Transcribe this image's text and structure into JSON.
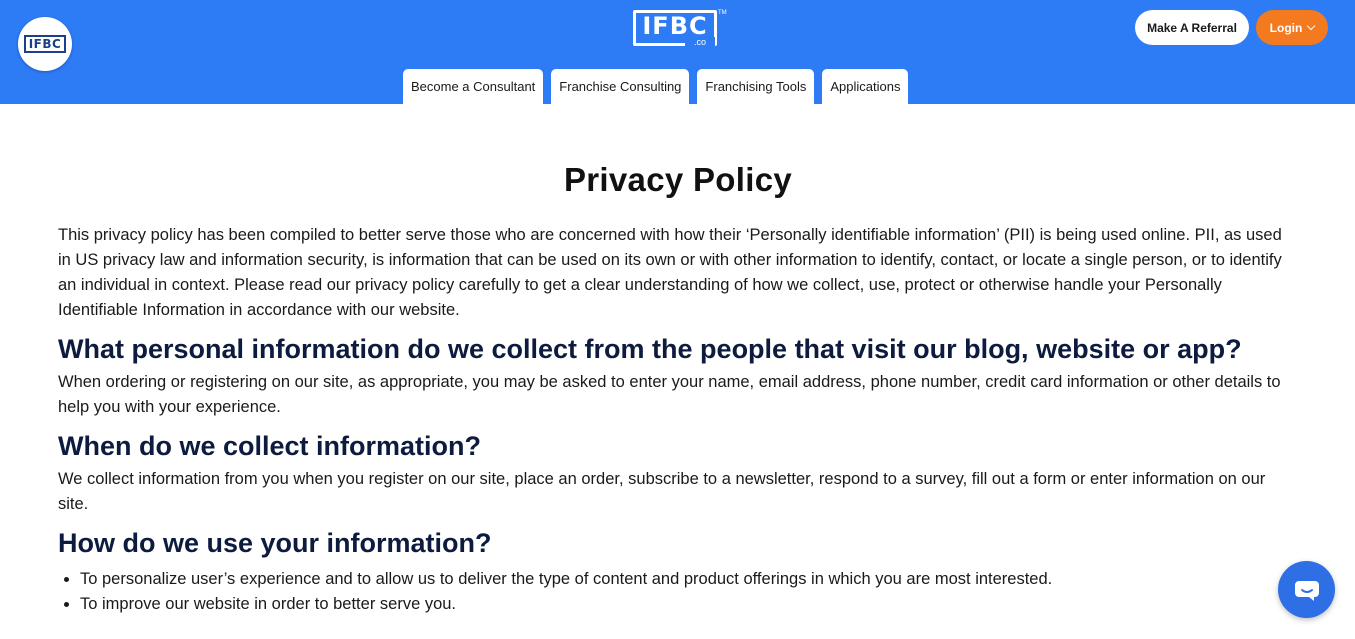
{
  "header": {
    "side_logo_text": "IFBC",
    "logo_main": "IFBC",
    "logo_sub": ".co",
    "logo_tm": "TM",
    "referral_label": "Make A Referral",
    "login_label": "Login",
    "brand_color": "#2e7bf6",
    "login_color": "#f47a1f"
  },
  "nav": {
    "tabs": [
      {
        "label": "Become a Consultant"
      },
      {
        "label": "Franchise Consulting"
      },
      {
        "label": "Franchising Tools"
      },
      {
        "label": "Applications"
      }
    ]
  },
  "main": {
    "title": "Privacy Policy",
    "intro": "This privacy policy has been compiled to better serve those who are concerned with how their ‘Personally identifiable information’ (PII) is being used online. PII, as used in US privacy law and information security, is information that can be used on its own or with other information to identify, contact, or locate a single person, or to identify an individual in context. Please read our privacy policy carefully to get a clear understanding of how we collect, use, protect or otherwise handle your Personally Identifiable Information in accordance with our website.",
    "sections": [
      {
        "heading": "What personal information do we collect from the people that visit our blog, website or app?",
        "body": "When ordering or registering on our site, as appropriate, you may be asked to enter your name, email address, phone number, credit card information or other details to help you with your experience."
      },
      {
        "heading": "When do we collect information?",
        "body": "We collect information from you when you register on our site, place an order, subscribe to a newsletter, respond to a survey, fill out a form or enter information on our site."
      },
      {
        "heading": "How do we use your information?",
        "items": [
          "To personalize user’s experience and to allow us to deliver the type of content and product offerings in which you are most interested.",
          "To improve our website in order to better serve you."
        ]
      }
    ]
  },
  "chat": {
    "icon": "chat-bubble-icon"
  }
}
